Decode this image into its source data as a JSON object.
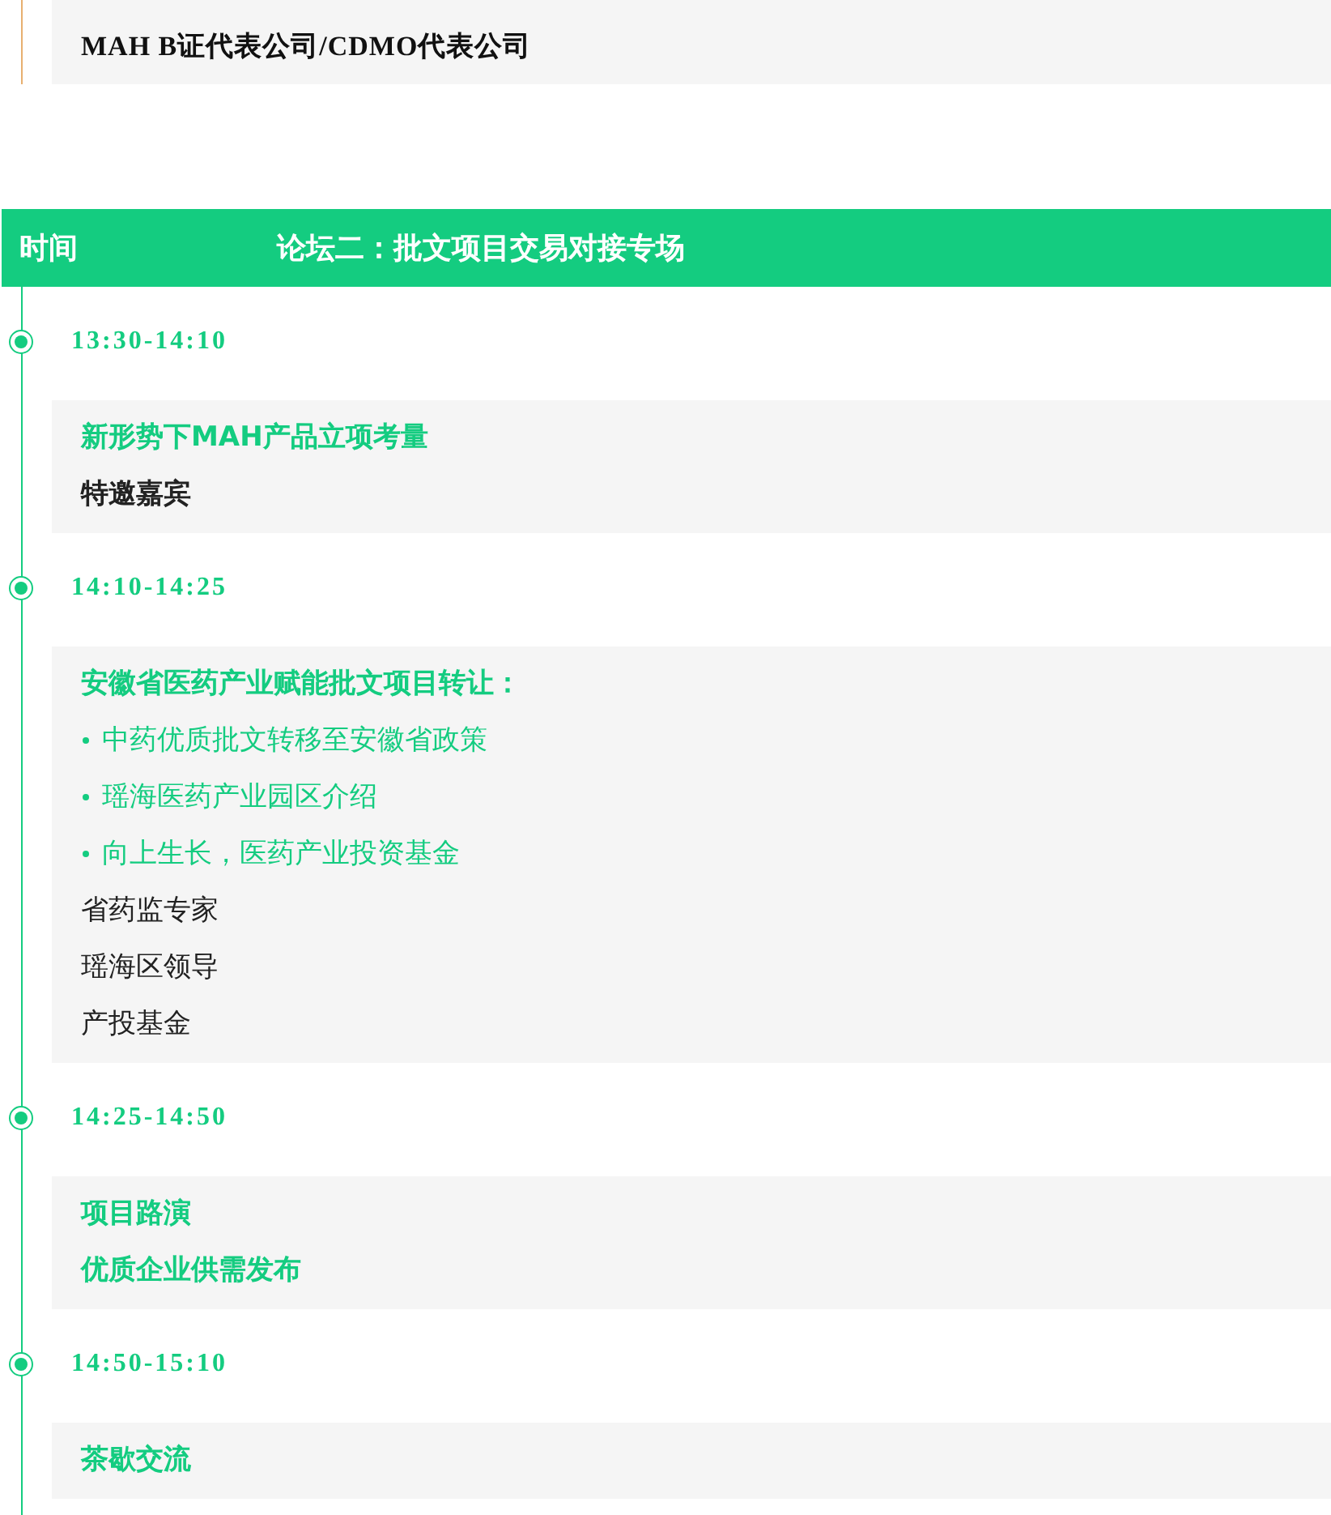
{
  "previous_card": {
    "text": "MAH B证代表公司/CDMO代表公司"
  },
  "header": {
    "time_label": "时间",
    "title": "论坛二：批文项目交易对接专场"
  },
  "sessions": [
    {
      "time": "13:30-14:10",
      "lines": [
        {
          "kind": "title",
          "text": "新形势下MAH产品立项考量"
        },
        {
          "kind": "speaker",
          "text": "特邀嘉宾"
        }
      ]
    },
    {
      "time": "14:10-14:25",
      "lines": [
        {
          "kind": "title",
          "text": "安徽省医药产业赋能批文项目转让："
        },
        {
          "kind": "bullet",
          "text": "中药优质批文转移至安徽省政策"
        },
        {
          "kind": "bullet",
          "text": "瑶海医药产业园区介绍"
        },
        {
          "kind": "bullet",
          "text": "向上生长，医药产业投资基金"
        },
        {
          "kind": "plain",
          "text": "省药监专家"
        },
        {
          "kind": "plain",
          "text": "瑶海区领导"
        },
        {
          "kind": "plain",
          "text": "产投基金"
        }
      ]
    },
    {
      "time": "14:25-14:50",
      "lines": [
        {
          "kind": "title",
          "text": "项目路演"
        },
        {
          "kind": "title",
          "text": "优质企业供需发布"
        }
      ]
    },
    {
      "time": "14:50-15:10",
      "lines": [
        {
          "kind": "title",
          "text": "茶歇交流"
        }
      ]
    }
  ]
}
